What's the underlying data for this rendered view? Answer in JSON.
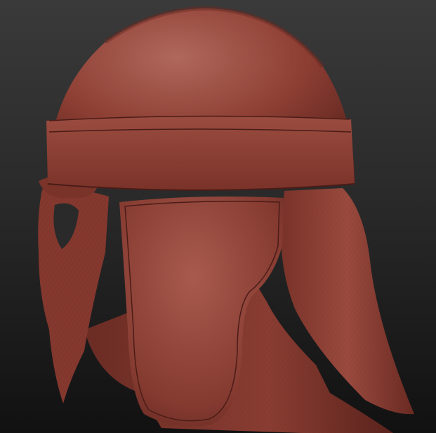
{
  "scene": {
    "subject": "helmet-sculpt",
    "background_colors": [
      "#3a3a3a",
      "#111111"
    ],
    "material_color": "#8e3f34",
    "highlight_color": "#b0685c",
    "shadow_color": "#4a1c17"
  }
}
